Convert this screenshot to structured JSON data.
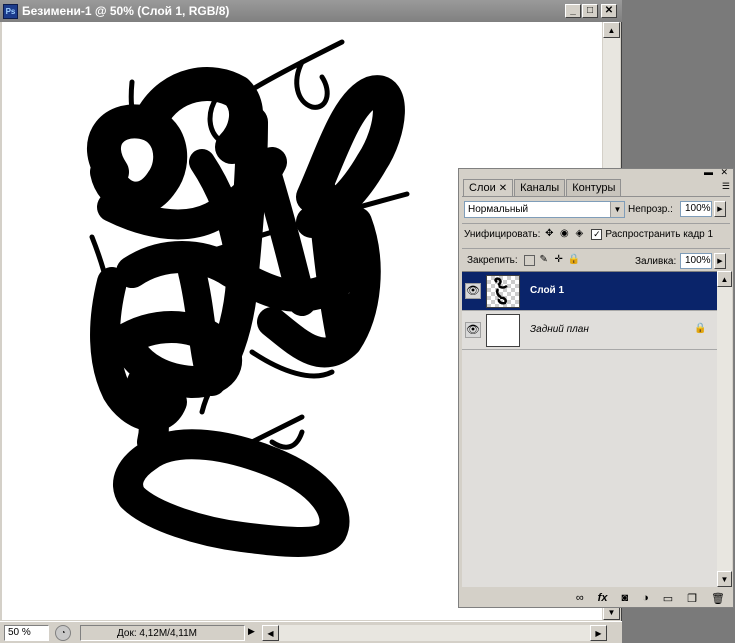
{
  "window": {
    "title": "Безимени-1 @ 50% (Слой 1, RGB/8)",
    "app_icon": "Ps",
    "minimize_glyph": "_",
    "maximize_glyph": "□",
    "close_glyph": "✕"
  },
  "status": {
    "zoom": "50 %",
    "doc_info": "Док: 4,12M/4,11M"
  },
  "panel": {
    "tabs": [
      {
        "label": "Слои",
        "active": true,
        "close": "✕"
      },
      {
        "label": "Каналы",
        "active": false
      },
      {
        "label": "Контуры",
        "active": false
      }
    ],
    "blend_mode": "Нормальный",
    "opacity_label": "Непрозр.:",
    "opacity_value": "100%",
    "unify_label": "Унифицировать:",
    "propagate_label": "Распространить кадр 1",
    "propagate_checked": "✓",
    "lock_label": "Закрепить:",
    "fill_label": "Заливка:",
    "fill_value": "100%",
    "layers": [
      {
        "name": "Слой 1",
        "selected": true,
        "eye": "👁"
      },
      {
        "name": "Задний план",
        "selected": false,
        "eye": "👁",
        "lock": "🔒"
      }
    ]
  },
  "icons": {
    "link": "link-icon",
    "fx": "fx",
    "mask": "mask-icon",
    "adjustment": "adjustment-icon",
    "group": "folder-icon",
    "new_layer": "new-layer-icon",
    "trash": "trash-icon"
  },
  "colors": {
    "selection": "#0a246a",
    "titlebar": "#808080"
  }
}
